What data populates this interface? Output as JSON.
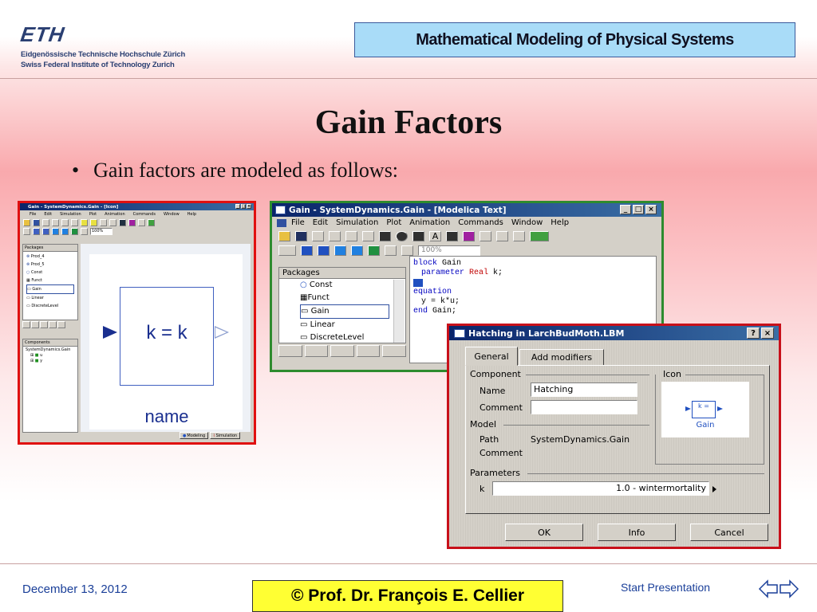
{
  "header": {
    "logo": "ETH",
    "institution_line1": "Eidgenössische Technische Hochschule Zürich",
    "institution_line2": "Swiss Federal Institute of Technology Zurich",
    "course_title": "Mathematical Modeling of Physical Systems"
  },
  "slide": {
    "title": "Gain Factors",
    "bullet": "Gain factors are modeled as follows:",
    "bullet_symbol": "•"
  },
  "left_window": {
    "title": "Gain - SystemDynamics.Gain - [Icon]",
    "menu": [
      "File",
      "Edit",
      "Simulation",
      "Plot",
      "Animation",
      "Commands",
      "Window",
      "Help"
    ],
    "zoom": "100%",
    "packages_header": "Packages",
    "packages": [
      "Prod_4",
      "Prod_5",
      "Const",
      "Funct",
      "Gain",
      "Linear",
      "DiscreteLevel"
    ],
    "components_header": "Components",
    "components": [
      "SystemDynamics.Gain",
      "u",
      "y"
    ],
    "canvas_label": "k = k",
    "canvas_name": "name",
    "tab_modeling": "Modeling",
    "tab_simulation": "Simulation",
    "win_buttons": [
      "_",
      "□",
      "×"
    ]
  },
  "middle_window": {
    "title": "Gain - SystemDynamics.Gain - [Modelica Text]",
    "menu": [
      "File",
      "Edit",
      "Simulation",
      "Plot",
      "Animation",
      "Commands",
      "Window",
      "Help"
    ],
    "zoom": "100%",
    "packages_header": "Packages",
    "packages": [
      "Const",
      "Funct",
      "Gain",
      "Linear",
      "DiscreteLevel"
    ],
    "code": {
      "line1_kw": "block",
      "line1_rest": " Gain",
      "line2_kw": "parameter",
      "line2_type": "Real",
      "line2_rest": " k;",
      "line4_kw": "equation",
      "line5": "y = k*u;",
      "line6_kw": "end",
      "line6_rest": " Gain;"
    },
    "win_buttons": [
      "_",
      "□",
      "×"
    ]
  },
  "dialog": {
    "title": "Hatching in LarchBudMoth.LBM",
    "help_btn": "?",
    "close_btn": "×",
    "tabs": [
      "General",
      "Add modifiers"
    ],
    "component_group": "Component",
    "name_label": "Name",
    "name_value": "Hatching",
    "comment_label": "Comment",
    "comment_value": "",
    "icon_group": "Icon",
    "icon_text": "k =",
    "icon_caption": "Gain",
    "model_group": "Model",
    "path_label": "Path",
    "path_value": "SystemDynamics.Gain",
    "model_comment_label": "Comment",
    "parameters_group": "Parameters",
    "param_k_label": "k",
    "param_k_value": "1.0 - wintermortality",
    "ok": "OK",
    "info": "Info",
    "cancel": "Cancel"
  },
  "footer": {
    "date": "December 13, 2012",
    "copyright": "©  Prof. Dr. François E. Cellier",
    "start": "Start Presentation"
  },
  "colors": {
    "course_box": "#a9dcf8",
    "footer_box": "#ffff33",
    "left_frame": "#e01010",
    "mid_frame": "#2e8b2e",
    "dialog_frame": "#c8101a",
    "titlebar": "#0a246a",
    "footer_text": "#1a3f99"
  }
}
